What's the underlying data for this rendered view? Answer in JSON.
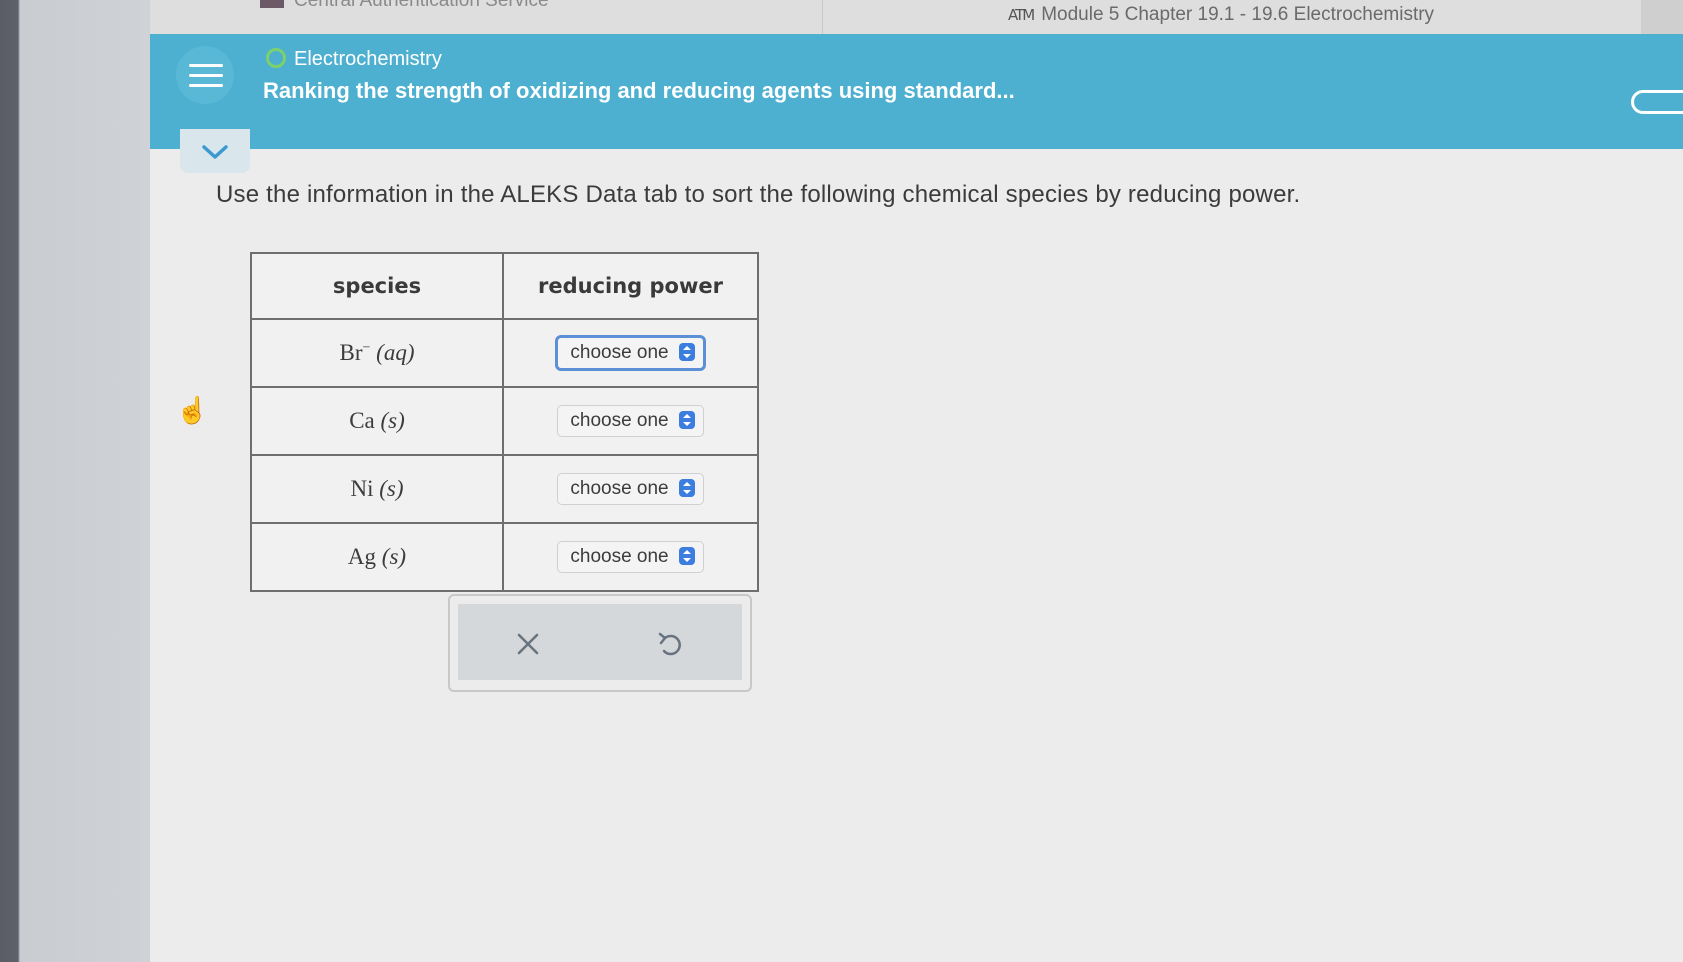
{
  "browser": {
    "tabs": [
      {
        "label": "Central Authentication Service"
      },
      {
        "label": "Module 5 Chapter 19.1 - 19.6 Electrochemistry",
        "favicon": "ATM"
      }
    ]
  },
  "header": {
    "topic": "Electrochemistry",
    "title": "Ranking the strength of oxidizing and reducing agents using standard...",
    "colors": {
      "background": "#4eb0d0",
      "topic_dot": "#7bd16b"
    }
  },
  "question": {
    "instruction": "Use the information in the ALEKS Data tab to sort the following chemical species by reducing power."
  },
  "table": {
    "headers": {
      "species": "species",
      "power": "reducing power"
    },
    "rows": [
      {
        "symbol": "Br",
        "charge": "−",
        "state": "(aq)",
        "selection": "choose one",
        "focused": true
      },
      {
        "symbol": "Ca",
        "charge": "",
        "state": "(s)",
        "selection": "choose one",
        "focused": false
      },
      {
        "symbol": "Ni",
        "charge": "",
        "state": "(s)",
        "selection": "choose one",
        "focused": false
      },
      {
        "symbol": "Ag",
        "charge": "",
        "state": "(s)",
        "selection": "choose one",
        "focused": false
      }
    ]
  },
  "actions": {
    "clear_icon": "close-icon",
    "undo_icon": "undo-icon"
  }
}
